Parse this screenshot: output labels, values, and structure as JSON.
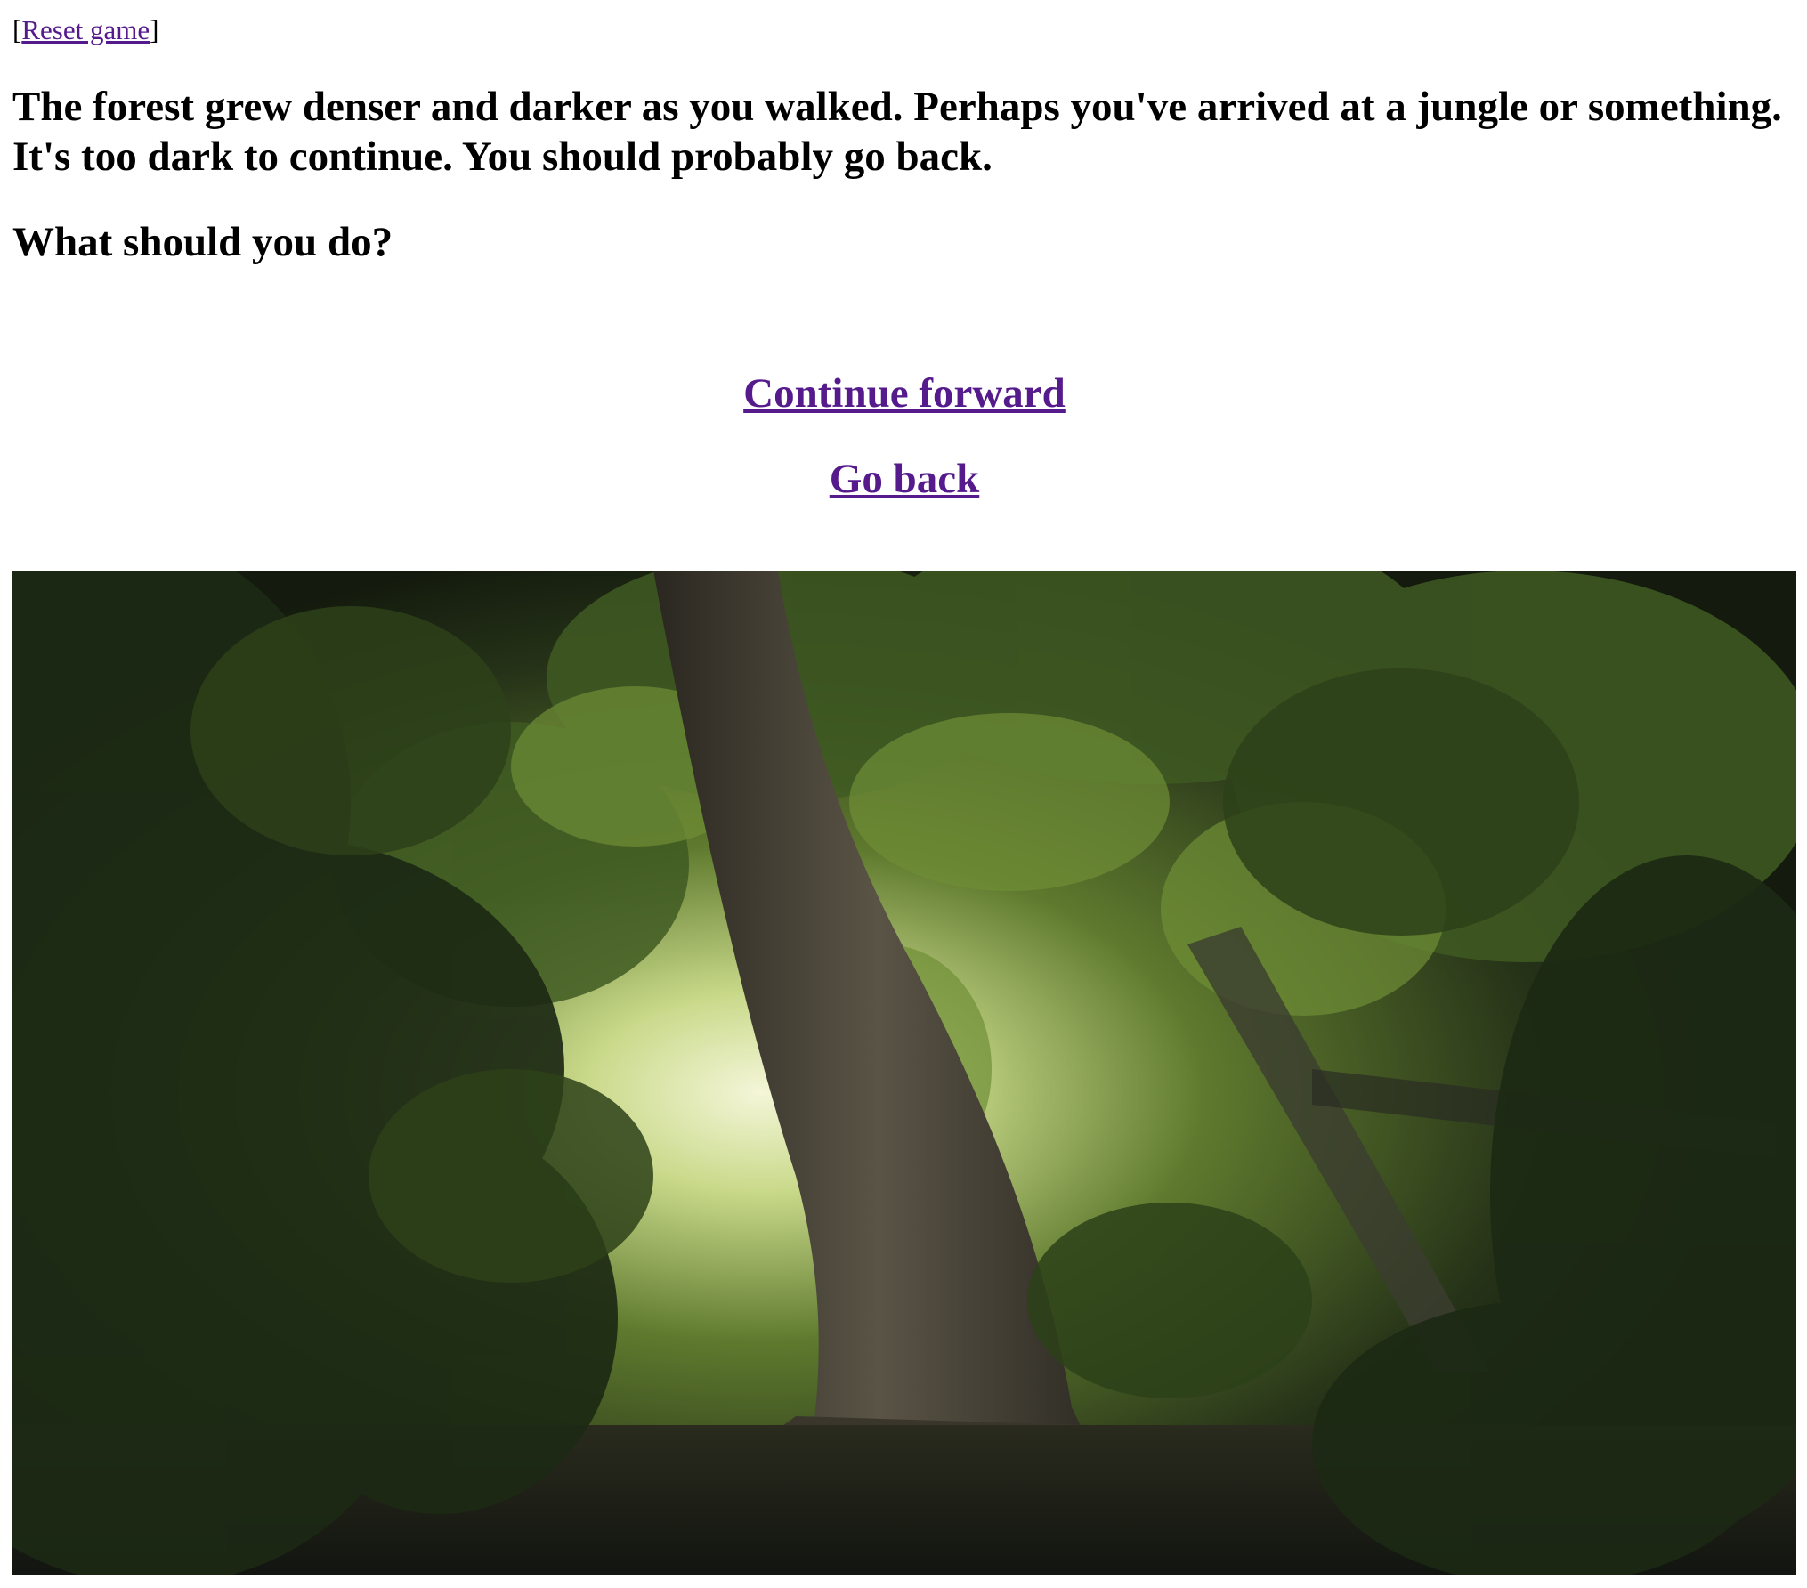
{
  "header": {
    "bracket_open": "[",
    "reset_label": "Reset game",
    "bracket_close": "]"
  },
  "story": {
    "text": "The forest grew denser and darker as you walked. Perhaps you've arrived at a jungle or something. It's too dark to continue. You should probably go back.",
    "prompt": "What should you do?"
  },
  "choices": [
    {
      "label": "Continue forward"
    },
    {
      "label": "Go back"
    }
  ],
  "scene_image": {
    "description_icon": "forest-scene-image"
  },
  "colors": {
    "link": "#551a8b",
    "text": "#000000",
    "background": "#ffffff"
  }
}
